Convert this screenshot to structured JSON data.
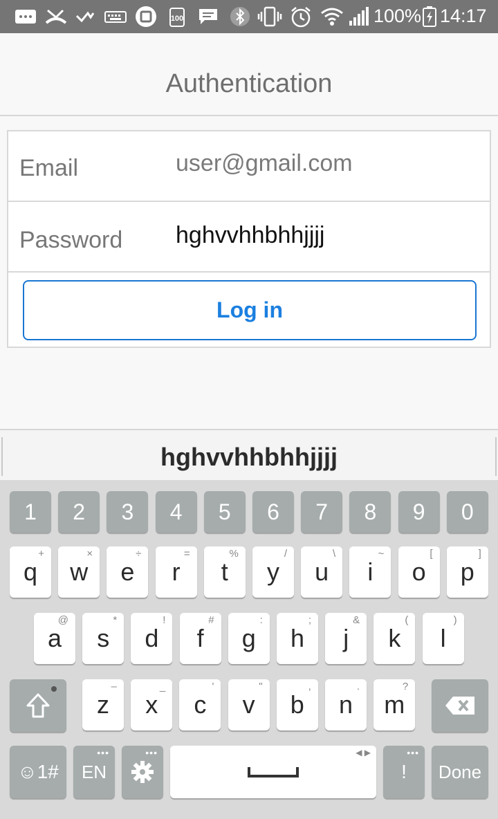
{
  "status_bar": {
    "battery_percent": "100%",
    "time": "14:17",
    "icons": [
      "message-icon",
      "missed-call-icon",
      "check-icon",
      "keyboard-icon",
      "app-icon",
      "battery-saver-icon",
      "chat-icon",
      "bluetooth-icon",
      "vibrate-icon",
      "alarm-icon",
      "wifi-icon",
      "signal-icon",
      "battery-icon"
    ]
  },
  "header": {
    "title": "Authentication"
  },
  "form": {
    "email_label": "Email",
    "email_value": "user@gmail.com",
    "password_label": "Password",
    "password_value": "hghvvhhbhhjjjj",
    "login_label": "Log in"
  },
  "keyboard": {
    "suggestion": "hghvvhhbhhjjjj",
    "number_row": [
      "1",
      "2",
      "3",
      "4",
      "5",
      "6",
      "7",
      "8",
      "9",
      "0"
    ],
    "row1": [
      {
        "key": "q",
        "hint": "+"
      },
      {
        "key": "w",
        "hint": "×"
      },
      {
        "key": "e",
        "hint": "÷"
      },
      {
        "key": "r",
        "hint": "="
      },
      {
        "key": "t",
        "hint": "%"
      },
      {
        "key": "y",
        "hint": "/"
      },
      {
        "key": "u",
        "hint": "\\"
      },
      {
        "key": "i",
        "hint": "~"
      },
      {
        "key": "o",
        "hint": "["
      },
      {
        "key": "p",
        "hint": "]"
      }
    ],
    "row2": [
      {
        "key": "a",
        "hint": "@"
      },
      {
        "key": "s",
        "hint": "*"
      },
      {
        "key": "d",
        "hint": "!"
      },
      {
        "key": "f",
        "hint": "#"
      },
      {
        "key": "g",
        "hint": ":"
      },
      {
        "key": "h",
        "hint": ";"
      },
      {
        "key": "j",
        "hint": "&"
      },
      {
        "key": "k",
        "hint": "("
      },
      {
        "key": "l",
        "hint": ")"
      }
    ],
    "row3": [
      {
        "key": "z",
        "hint": "–"
      },
      {
        "key": "x",
        "hint": "_"
      },
      {
        "key": "c",
        "hint": "'"
      },
      {
        "key": "v",
        "hint": "\""
      },
      {
        "key": "b",
        "hint": ","
      },
      {
        "key": "n",
        "hint": "."
      },
      {
        "key": "m",
        "hint": "?"
      }
    ],
    "symbols_label": "☺1#",
    "language_label": "EN",
    "exclaim_label": "!",
    "done_label": "Done"
  },
  "colors": {
    "accent": "#1b7fe0",
    "status_bar": "#757575",
    "keyboard_bg": "#d9d9d9",
    "func_key": "#a6acac"
  }
}
